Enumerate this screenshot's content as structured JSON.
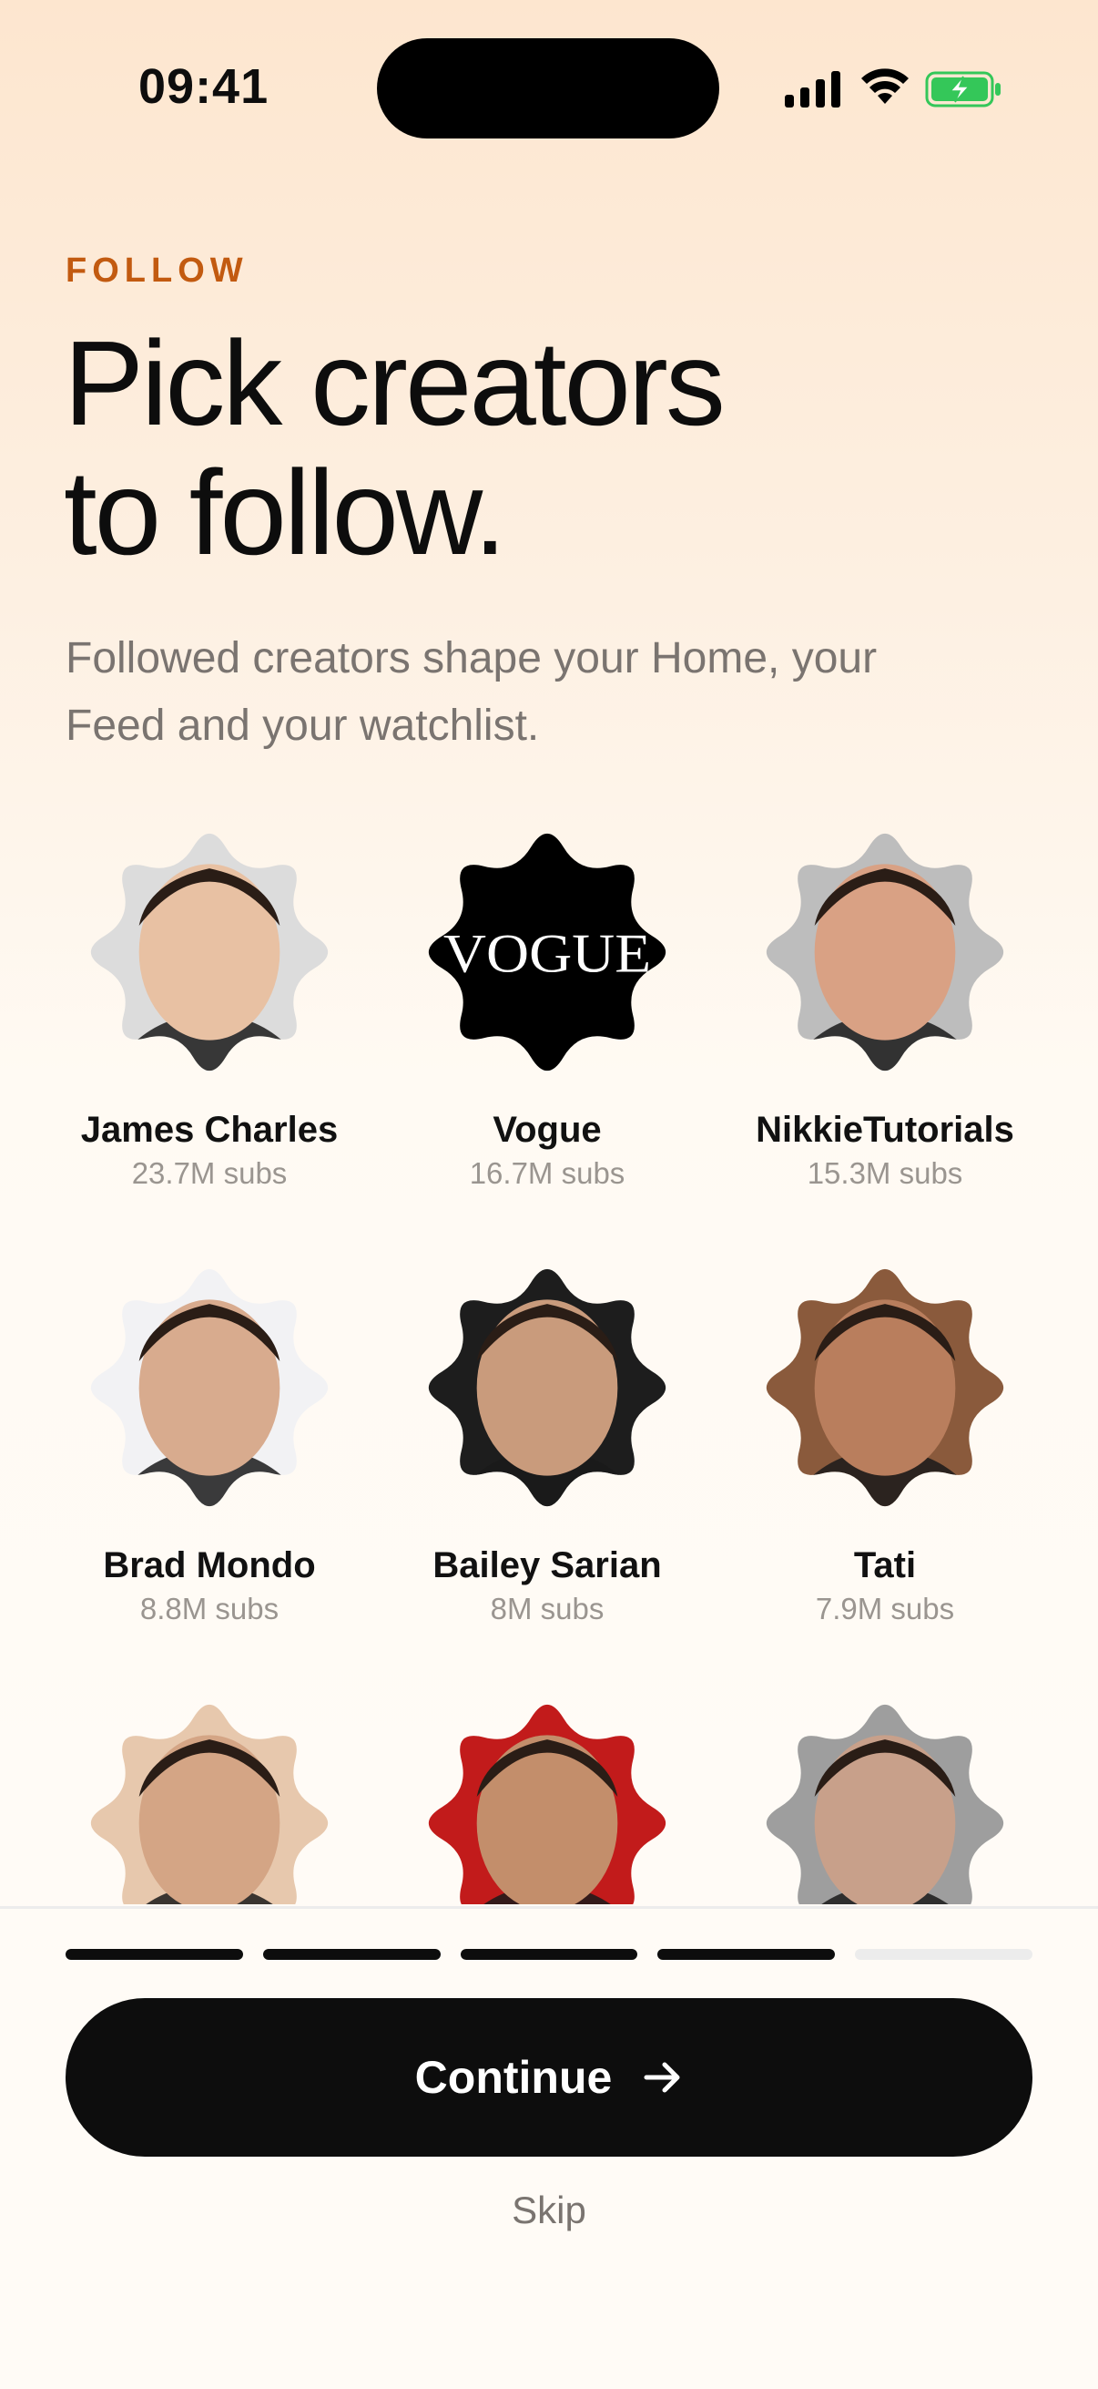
{
  "status_bar": {
    "time": "09:41"
  },
  "header": {
    "eyebrow": "FOLLOW",
    "title_line1": "Pick creators",
    "title_line2": "to follow.",
    "subtitle": "Followed creators shape your Home, your Feed and your watchlist."
  },
  "creators": [
    {
      "name": "James Charles",
      "subs": "23.7M subs",
      "tone": "#e8c1a3",
      "bg": "#dcdcdc"
    },
    {
      "name": "Vogue",
      "subs": "16.7M subs",
      "logo_text": "VOGUE",
      "tone": "#000000",
      "bg": "#000000"
    },
    {
      "name": "NikkieTutorials",
      "subs": "15.3M subs",
      "tone": "#d9a184",
      "bg": "#bdbdbd"
    },
    {
      "name": "Brad Mondo",
      "subs": "8.8M subs",
      "tone": "#d8ab8e",
      "bg": "#f2f2f4"
    },
    {
      "name": "Bailey Sarian",
      "subs": "8M subs",
      "tone": "#c99b7c",
      "bg": "#1d1d1d"
    },
    {
      "name": "Tati",
      "subs": "7.9M subs",
      "tone": "#b97e5d",
      "bg": "#8a5a3c"
    },
    {
      "name": "",
      "subs": "",
      "tone": "#d4a585",
      "bg": "#e7c8ad"
    },
    {
      "name": "",
      "subs": "",
      "tone": "#c38e6b",
      "bg": "#c21b1b"
    },
    {
      "name": "",
      "subs": "",
      "tone": "#c8a08a",
      "bg": "#9e9e9e"
    }
  ],
  "progress": {
    "total_steps": 5,
    "completed_steps": 4
  },
  "actions": {
    "continue_label": "Continue",
    "skip_label": "Skip"
  },
  "colors": {
    "accent": "#c25a10",
    "primary": "#0d0d0d",
    "muted": "#7a7470"
  }
}
